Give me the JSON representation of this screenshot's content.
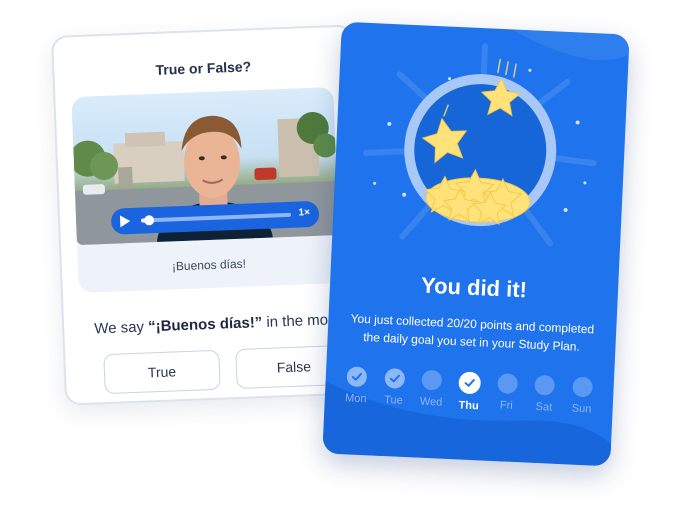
{
  "quiz": {
    "title": "True or False?",
    "video": {
      "caption": "¡Buenos días!",
      "speed": "1×",
      "progress_fraction": 0.05
    },
    "statement_prefix": "We say ",
    "statement_bold": "“¡Buenos días!”",
    "statement_suffix": " in the mornin",
    "answers": [
      "True",
      "False"
    ]
  },
  "success": {
    "title": "You did it!",
    "message": "You just collected 20/20 points and completed the daily goal you set in your Study Plan.",
    "days": [
      {
        "label": "Mon",
        "state": "done"
      },
      {
        "label": "Tue",
        "state": "done"
      },
      {
        "label": "Wed",
        "state": "pending"
      },
      {
        "label": "Thu",
        "state": "today"
      },
      {
        "label": "Fri",
        "state": "pending"
      },
      {
        "label": "Sat",
        "state": "pending"
      },
      {
        "label": "Sun",
        "state": "pending"
      }
    ]
  },
  "colors": {
    "brand_blue": "#1f73ec",
    "player_blue": "#1a64e0",
    "star_yellow": "#ffe27a"
  },
  "icons": {
    "play": "play-icon",
    "check": "check-icon",
    "star": "star-icon"
  }
}
